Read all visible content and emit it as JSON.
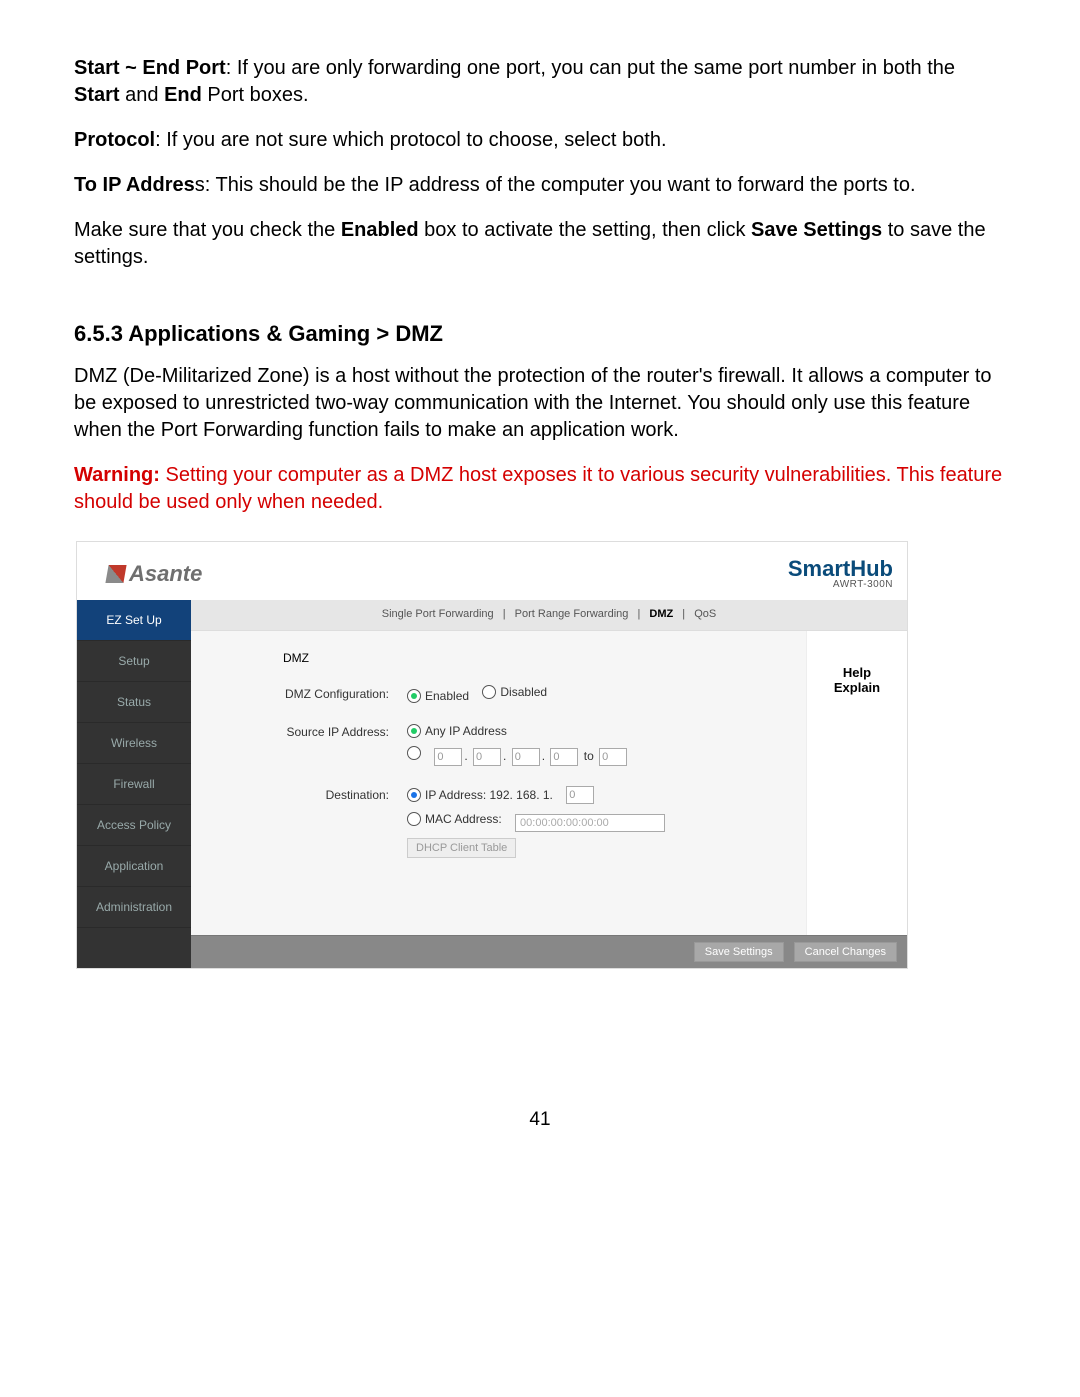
{
  "doc": {
    "p1_bold": "Start ~ End Port",
    "p1_rest": ": If you are only forwarding one port, you can put the same port number in both the ",
    "p1_b2": "Start",
    "p1_mid": " and ",
    "p1_b3": "End",
    "p1_end": " Port boxes.",
    "p2_bold": "Protocol",
    "p2_rest": ": If you are not sure which protocol to choose, select both.",
    "p3_bold": "To IP Addres",
    "p3_s": "s",
    "p3_rest": ": This should be the IP address of the computer you want to forward the ports to.",
    "p4_a": "Make sure that you check the ",
    "p4_b1": "Enabled",
    "p4_b": " box to activate the setting, then click ",
    "p4_b2": "Save Settings",
    "p4_c": " to save the settings.",
    "section": "6.5.3 Applications & Gaming > DMZ",
    "dmz_desc": "DMZ (De-Militarized Zone) is a host without the protection of the router's firewall. It allows a computer to be exposed to unrestricted two-way communication with the Internet. You should only use this feature when the Port Forwarding function fails to make an application work.",
    "warn_label": "Warning:",
    "warn_text": " Setting your computer as a DMZ host exposes it to various security vulnerabilities. This feature should be used only when needed.",
    "page_number": "41"
  },
  "router": {
    "brand": "Asante",
    "product": "SmartHub",
    "model": "AWRT-300N",
    "sidebar": [
      "EZ Set Up",
      "Setup",
      "Status",
      "Wireless",
      "Firewall",
      "Access Policy",
      "Application",
      "Administration"
    ],
    "subnav": {
      "items": [
        "Single Port Forwarding",
        "Port Range Forwarding",
        "DMZ",
        "QoS"
      ],
      "active_index": 2
    },
    "section_label": "DMZ",
    "rows": {
      "config_label": "DMZ Configuration:",
      "enabled": "Enabled",
      "disabled": "Disabled",
      "src_label": "Source IP Address:",
      "any_ip": "Any IP Address",
      "to": "to",
      "ip_octet": "0",
      "dest_label": "Destination:",
      "dest_ip_prefix": "IP Address: 192. 168. 1.",
      "dest_ip_last": "0",
      "mac_label": "MAC Address:",
      "mac_value": "00:00:00:00:00:00",
      "dhcp_btn": "DHCP Client Table"
    },
    "help": {
      "line1": "Help",
      "line2": "Explain"
    },
    "footer": {
      "save": "Save Settings",
      "cancel": "Cancel Changes"
    }
  }
}
